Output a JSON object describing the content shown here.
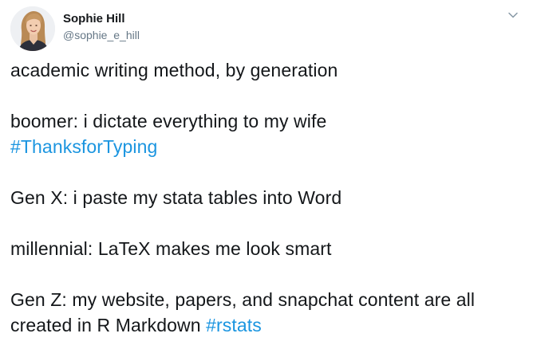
{
  "author": {
    "display_name": "Sophie Hill",
    "handle": "@sophie_e_hill",
    "avatar_icon": "profile-photo"
  },
  "menu": {
    "icon": "chevron-down-icon"
  },
  "tweet": {
    "title_line": "academic writing method, by generation",
    "boomer_text": "boomer: i dictate everything to my wife",
    "boomer_hashtag": "#ThanksforTyping",
    "genx_text": "Gen X: i paste my stata tables into Word",
    "millennial_text": "millennial: LaTeX makes me look smart",
    "genz_text": "Gen Z: my website, papers, and snapchat content are all created in R Markdown",
    "genz_hashtag": "#rstats"
  },
  "colors": {
    "text": "#14171a",
    "secondary": "#657786",
    "link": "#1b95e0"
  }
}
